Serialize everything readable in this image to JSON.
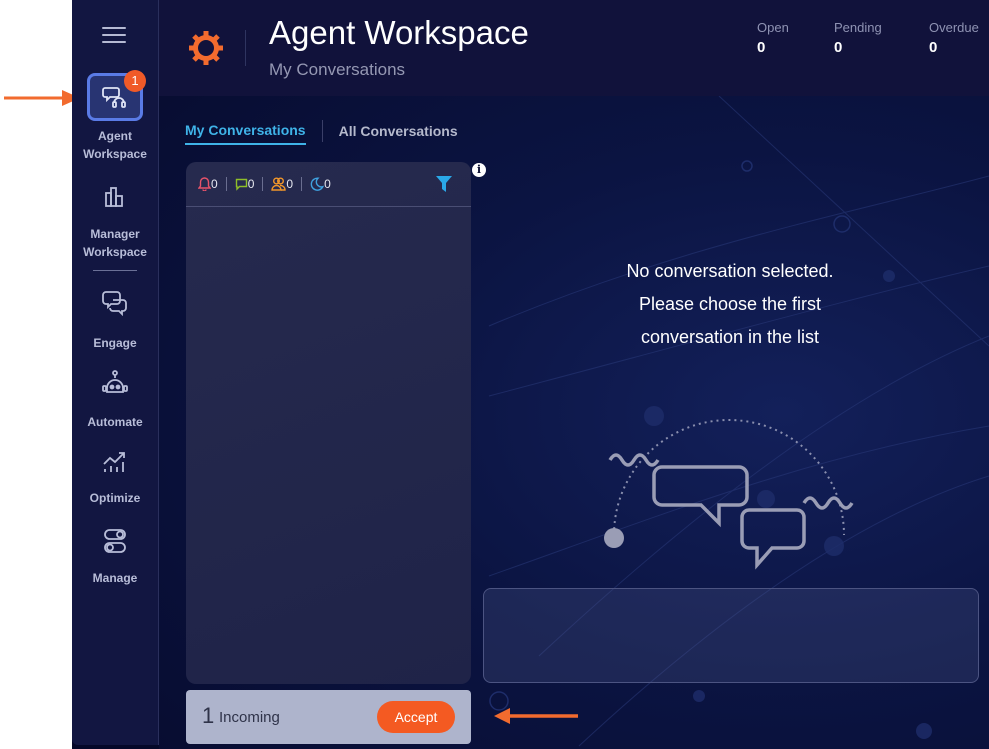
{
  "sidebar": {
    "menu_icon": "hamburger-menu-icon",
    "items": [
      {
        "label_line1": "Agent",
        "label_line2": "Workspace",
        "icon": "chat-headset-icon",
        "active": true,
        "badge": "1"
      },
      {
        "label_line1": "Manager",
        "label_line2": "Workspace",
        "icon": "bar-chart-icon"
      },
      {
        "label": "Engage",
        "icon": "chat-bubbles-icon"
      },
      {
        "label": "Automate",
        "icon": "robot-icon"
      },
      {
        "label": "Optimize",
        "icon": "trend-chart-icon"
      },
      {
        "label": "Manage",
        "icon": "toggles-icon"
      }
    ]
  },
  "header": {
    "logo_icon": "gear-logo-icon",
    "title": "Agent Workspace",
    "subtitle": "My Conversations",
    "stats": [
      {
        "label": "Open",
        "value": "0"
      },
      {
        "label": "Pending",
        "value": "0"
      },
      {
        "label": "Overdue",
        "value": "0"
      }
    ]
  },
  "tabs": [
    {
      "label": "My Conversations",
      "active": true
    },
    {
      "label": "All Conversations",
      "active": false
    }
  ],
  "filters": [
    {
      "icon": "bell-icon",
      "count": "0",
      "color": "#e8536a"
    },
    {
      "icon": "message-icon",
      "count": "0",
      "color": "#8fbf2a"
    },
    {
      "icon": "users-icon",
      "count": "0",
      "color": "#f0962a"
    },
    {
      "icon": "moon-icon",
      "count": "0",
      "color": "#3fa2e0"
    }
  ],
  "filter_color": "#2aa8e8",
  "empty_state": {
    "line1": "No conversation selected.",
    "line2": "Please choose the first",
    "line3": "conversation in the list"
  },
  "incoming": {
    "count": "1",
    "label": "Incoming",
    "accept_label": "Accept"
  },
  "colors": {
    "accent": "#f45a22",
    "active_tab": "#3fb3e8",
    "annotation_arrow": "#f26b2e"
  }
}
